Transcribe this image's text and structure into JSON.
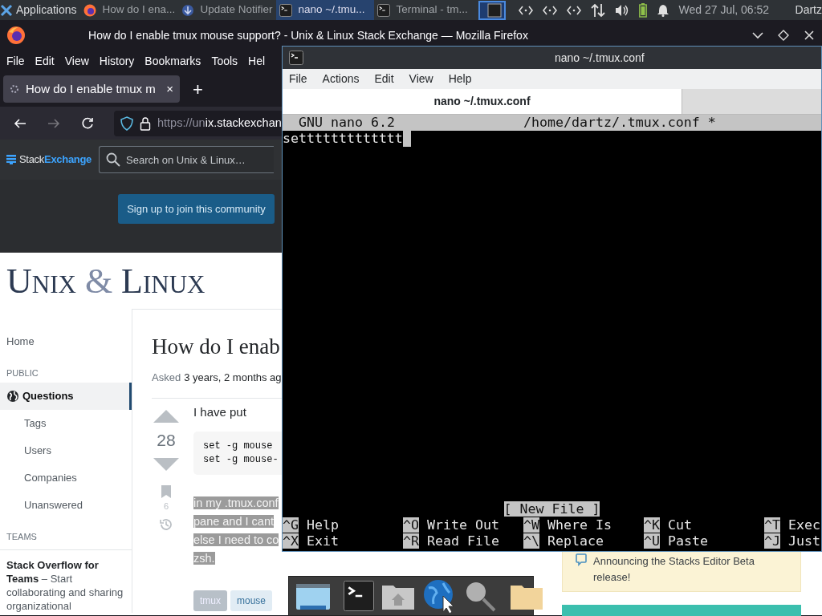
{
  "panel": {
    "apps_menu": "Applications",
    "tasks": [
      {
        "label": "How do I ena...",
        "kind": "browser",
        "selected": false
      },
      {
        "label": "Update Notifier",
        "kind": "update",
        "selected": false
      },
      {
        "label": "nano ~/.tmu...",
        "kind": "terminal",
        "selected": true
      },
      {
        "label": "Terminal - tm...",
        "kind": "terminal",
        "selected": false
      }
    ],
    "clock": "Wed 27 Jul, 06:52",
    "user": "Dartz"
  },
  "firefox": {
    "title": "How do I enable tmux mouse support? - Unix & Linux Stack Exchange — Mozilla Firefox",
    "menu": [
      "File",
      "Edit",
      "View",
      "History",
      "Bookmarks",
      "Tools",
      "Hel"
    ],
    "tabs": [
      {
        "label": "How do I enable tmux m",
        "close": "×",
        "selected": true
      }
    ],
    "new_tab": "+",
    "url_dim": "https://un",
    "url_host": "ix.stackexchan"
  },
  "page": {
    "brand": [
      "Stack",
      "Exchange"
    ],
    "search": {
      "placeholder": "Search on Unix & Linux…"
    },
    "signup": "Sign up to join this community",
    "logo": [
      "Unix",
      "&",
      "Linux"
    ],
    "nav": [
      {
        "kind": "link",
        "label": "Home",
        "selected": false
      },
      {
        "kind": "heading",
        "label": "PUBLIC"
      },
      {
        "kind": "link",
        "label": "Questions",
        "selected": true
      },
      {
        "kind": "sublink",
        "label": "Tags",
        "selected": false
      },
      {
        "kind": "sublink",
        "label": "Users",
        "selected": false
      },
      {
        "kind": "sublink",
        "label": "Companies",
        "selected": false
      },
      {
        "kind": "sublink",
        "label": "Unanswered",
        "selected": false
      },
      {
        "kind": "heading",
        "label": "TEAMS"
      }
    ],
    "teams": "**Stack Overflow for Teams** – Start collaborating and sharing organizational",
    "question": {
      "title": "How do I enab",
      "asked_label": "Asked",
      "asked": "3 years, 2 months ag",
      "votes": "28",
      "bookmarks": "6",
      "intro": "I have put",
      "code": [
        "set -g mouse",
        "set -g mouse-"
      ],
      "selected_lines": [
        {
          "text": "in my .tmux.conf",
          "highlighted": true
        },
        {
          "text": "pane and I cant",
          "highlighted": true
        },
        {
          "text": "else I need to co",
          "highlighted": true
        },
        {
          "text": "zsh.",
          "highlighted": true
        }
      ],
      "tags": [
        {
          "label": "tmux",
          "highlighted": true
        },
        {
          "label": "mouse",
          "highlighted": false
        }
      ]
    },
    "notice": "Announcing the Stacks Editor Beta release!"
  },
  "terminal": {
    "title": "nano ~/.tmux.conf",
    "menu": [
      "File",
      "Actions",
      "Edit",
      "View",
      "Help"
    ],
    "tabs": [
      {
        "label": "nano ~/.tmux.conf",
        "selected": true
      }
    ],
    "nano": {
      "version": "GNU nano 6.2",
      "file": "/home/dartz/.tmux.conf *",
      "lines": [
        "settttttttttttt"
      ],
      "status": "[ New File ]",
      "shortcuts": [
        [
          {
            "key": "^G",
            "label": "Help"
          },
          {
            "key": "^O",
            "label": "Write Out"
          },
          {
            "key": "^W",
            "label": "Where Is"
          },
          {
            "key": "^K",
            "label": "Cut"
          },
          {
            "key": "^T",
            "label": "Exec"
          }
        ],
        [
          {
            "key": "^X",
            "label": "Exit"
          },
          {
            "key": "^R",
            "label": "Read File"
          },
          {
            "key": "^\\",
            "label": "Replace"
          },
          {
            "key": "^U",
            "label": "Paste"
          },
          {
            "key": "^J",
            "label": "Just"
          }
        ]
      ]
    }
  }
}
